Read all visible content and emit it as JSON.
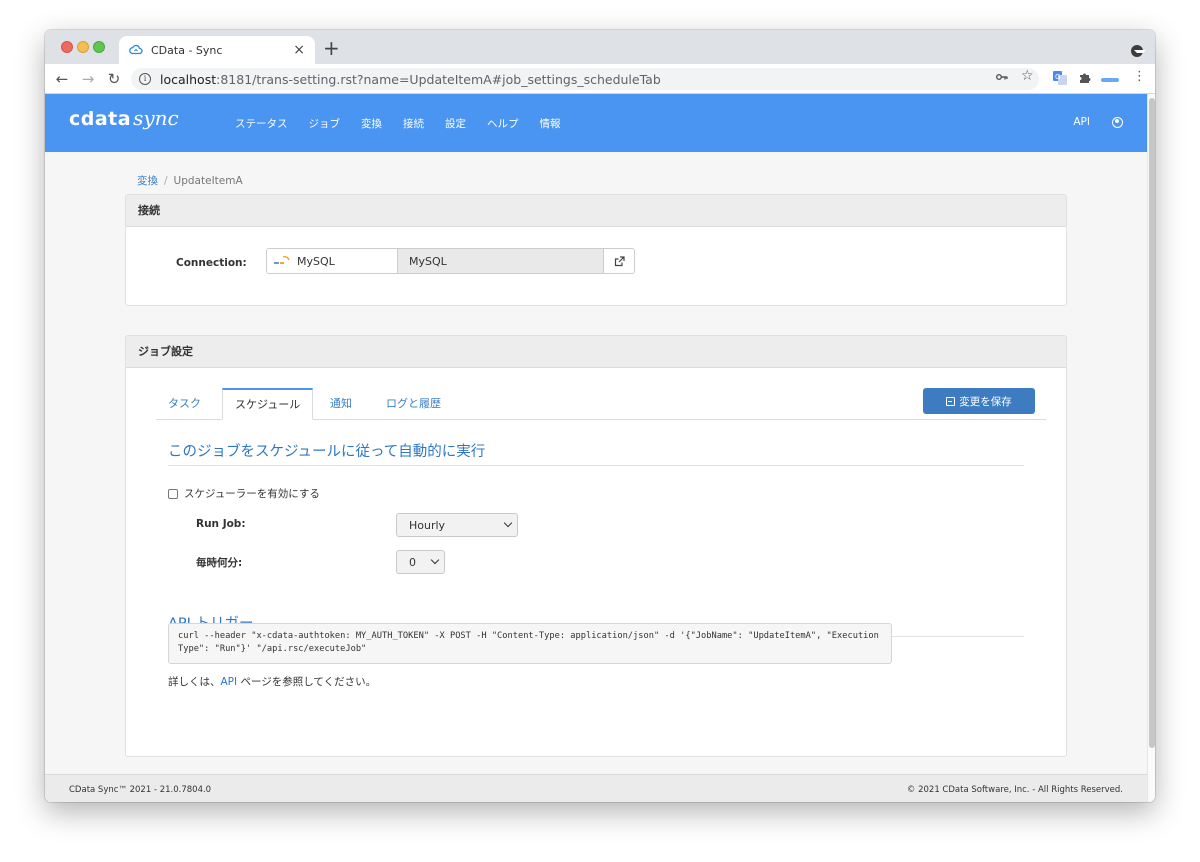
{
  "browser": {
    "tab_title": "CData - Sync",
    "tab_close": "×",
    "new_tab": "+",
    "url_host": "localhost",
    "url_path": ":8181/trans-setting.rst?name=UpdateItemA#job_settings_scheduleTab"
  },
  "nav": {
    "logo_left": "cdata",
    "logo_right": "sync",
    "menu": [
      "ステータス",
      "ジョブ",
      "変換",
      "接続",
      "設定",
      "ヘルプ",
      "情報"
    ],
    "api": "API"
  },
  "breadcrumb": {
    "parent": "変換",
    "separator": "/",
    "current": "UpdateItemA"
  },
  "connection_panel": {
    "title": "接続",
    "label": "Connection:",
    "selected": "MySQL",
    "logo_text": "MySQL",
    "readonly_value": "MySQL"
  },
  "job_panel": {
    "title": "ジョブ設定",
    "tabs": [
      "タスク",
      "スケジュール",
      "通知",
      "ログと履歴"
    ],
    "active_tab": "スケジュール",
    "save_button": "変更を保存",
    "schedule_title": "このジョブをスケジュールに従って自動的に実行",
    "enable_label": "スケジューラーを有効にする",
    "enable_checked": false,
    "run_job_label": "Run Job:",
    "run_job_value": "Hourly",
    "minute_label": "毎時何分:",
    "minute_value": "0",
    "api_title": "API トリガー",
    "curl": "curl --header \"x-cdata-authtoken: MY_AUTH_TOKEN\" -X POST -H \"Content-Type: application/json\" -d '{\"JobName\": \"UpdateItemA\", \"ExecutionType\": \"Run\"}' \"/api.rsc/executeJob\"",
    "api_note_prefix": "詳しくは、",
    "api_note_link": "API",
    "api_note_suffix": " ページを参照してください。"
  },
  "footer": {
    "left": "CData Sync™ 2021 - 21.0.7804.0",
    "right": "© 2021 CData Software, Inc. - All Rights Reserved."
  },
  "colors": {
    "nav_bg": "#4a94f2",
    "accent": "#2f77c3",
    "save_button": "#3d7cc0"
  }
}
